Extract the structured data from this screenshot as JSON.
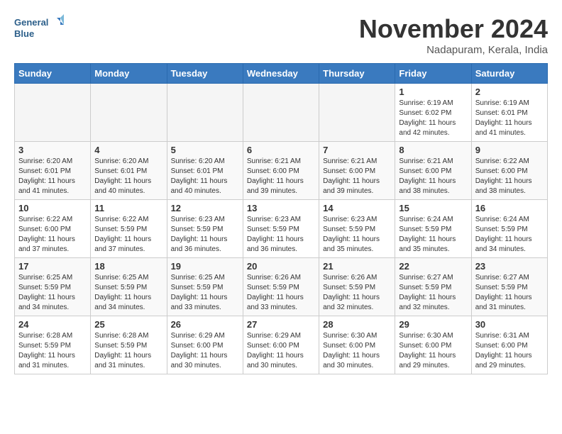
{
  "header": {
    "logo_line1": "General",
    "logo_line2": "Blue",
    "month": "November 2024",
    "location": "Nadapuram, Kerala, India"
  },
  "weekdays": [
    "Sunday",
    "Monday",
    "Tuesday",
    "Wednesday",
    "Thursday",
    "Friday",
    "Saturday"
  ],
  "weeks": [
    [
      {
        "day": "",
        "info": ""
      },
      {
        "day": "",
        "info": ""
      },
      {
        "day": "",
        "info": ""
      },
      {
        "day": "",
        "info": ""
      },
      {
        "day": "",
        "info": ""
      },
      {
        "day": "1",
        "info": "Sunrise: 6:19 AM\nSunset: 6:02 PM\nDaylight: 11 hours\nand 42 minutes."
      },
      {
        "day": "2",
        "info": "Sunrise: 6:19 AM\nSunset: 6:01 PM\nDaylight: 11 hours\nand 41 minutes."
      }
    ],
    [
      {
        "day": "3",
        "info": "Sunrise: 6:20 AM\nSunset: 6:01 PM\nDaylight: 11 hours\nand 41 minutes."
      },
      {
        "day": "4",
        "info": "Sunrise: 6:20 AM\nSunset: 6:01 PM\nDaylight: 11 hours\nand 40 minutes."
      },
      {
        "day": "5",
        "info": "Sunrise: 6:20 AM\nSunset: 6:01 PM\nDaylight: 11 hours\nand 40 minutes."
      },
      {
        "day": "6",
        "info": "Sunrise: 6:21 AM\nSunset: 6:00 PM\nDaylight: 11 hours\nand 39 minutes."
      },
      {
        "day": "7",
        "info": "Sunrise: 6:21 AM\nSunset: 6:00 PM\nDaylight: 11 hours\nand 39 minutes."
      },
      {
        "day": "8",
        "info": "Sunrise: 6:21 AM\nSunset: 6:00 PM\nDaylight: 11 hours\nand 38 minutes."
      },
      {
        "day": "9",
        "info": "Sunrise: 6:22 AM\nSunset: 6:00 PM\nDaylight: 11 hours\nand 38 minutes."
      }
    ],
    [
      {
        "day": "10",
        "info": "Sunrise: 6:22 AM\nSunset: 6:00 PM\nDaylight: 11 hours\nand 37 minutes."
      },
      {
        "day": "11",
        "info": "Sunrise: 6:22 AM\nSunset: 5:59 PM\nDaylight: 11 hours\nand 37 minutes."
      },
      {
        "day": "12",
        "info": "Sunrise: 6:23 AM\nSunset: 5:59 PM\nDaylight: 11 hours\nand 36 minutes."
      },
      {
        "day": "13",
        "info": "Sunrise: 6:23 AM\nSunset: 5:59 PM\nDaylight: 11 hours\nand 36 minutes."
      },
      {
        "day": "14",
        "info": "Sunrise: 6:23 AM\nSunset: 5:59 PM\nDaylight: 11 hours\nand 35 minutes."
      },
      {
        "day": "15",
        "info": "Sunrise: 6:24 AM\nSunset: 5:59 PM\nDaylight: 11 hours\nand 35 minutes."
      },
      {
        "day": "16",
        "info": "Sunrise: 6:24 AM\nSunset: 5:59 PM\nDaylight: 11 hours\nand 34 minutes."
      }
    ],
    [
      {
        "day": "17",
        "info": "Sunrise: 6:25 AM\nSunset: 5:59 PM\nDaylight: 11 hours\nand 34 minutes."
      },
      {
        "day": "18",
        "info": "Sunrise: 6:25 AM\nSunset: 5:59 PM\nDaylight: 11 hours\nand 34 minutes."
      },
      {
        "day": "19",
        "info": "Sunrise: 6:25 AM\nSunset: 5:59 PM\nDaylight: 11 hours\nand 33 minutes."
      },
      {
        "day": "20",
        "info": "Sunrise: 6:26 AM\nSunset: 5:59 PM\nDaylight: 11 hours\nand 33 minutes."
      },
      {
        "day": "21",
        "info": "Sunrise: 6:26 AM\nSunset: 5:59 PM\nDaylight: 11 hours\nand 32 minutes."
      },
      {
        "day": "22",
        "info": "Sunrise: 6:27 AM\nSunset: 5:59 PM\nDaylight: 11 hours\nand 32 minutes."
      },
      {
        "day": "23",
        "info": "Sunrise: 6:27 AM\nSunset: 5:59 PM\nDaylight: 11 hours\nand 31 minutes."
      }
    ],
    [
      {
        "day": "24",
        "info": "Sunrise: 6:28 AM\nSunset: 5:59 PM\nDaylight: 11 hours\nand 31 minutes."
      },
      {
        "day": "25",
        "info": "Sunrise: 6:28 AM\nSunset: 5:59 PM\nDaylight: 11 hours\nand 31 minutes."
      },
      {
        "day": "26",
        "info": "Sunrise: 6:29 AM\nSunset: 6:00 PM\nDaylight: 11 hours\nand 30 minutes."
      },
      {
        "day": "27",
        "info": "Sunrise: 6:29 AM\nSunset: 6:00 PM\nDaylight: 11 hours\nand 30 minutes."
      },
      {
        "day": "28",
        "info": "Sunrise: 6:30 AM\nSunset: 6:00 PM\nDaylight: 11 hours\nand 30 minutes."
      },
      {
        "day": "29",
        "info": "Sunrise: 6:30 AM\nSunset: 6:00 PM\nDaylight: 11 hours\nand 29 minutes."
      },
      {
        "day": "30",
        "info": "Sunrise: 6:31 AM\nSunset: 6:00 PM\nDaylight: 11 hours\nand 29 minutes."
      }
    ]
  ]
}
